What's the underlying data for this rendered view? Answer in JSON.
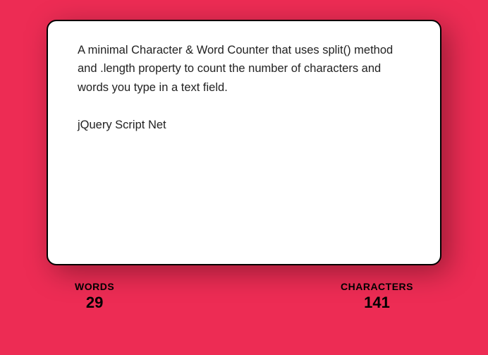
{
  "textarea": {
    "value": "A minimal Character & Word Counter that uses split() method and .length property to count the number of characters and words you type in a text field.\n\njQuery Script Net"
  },
  "counters": {
    "words": {
      "label": "WORDS",
      "value": "29"
    },
    "characters": {
      "label": "CHARACTERS",
      "value": "141"
    }
  }
}
